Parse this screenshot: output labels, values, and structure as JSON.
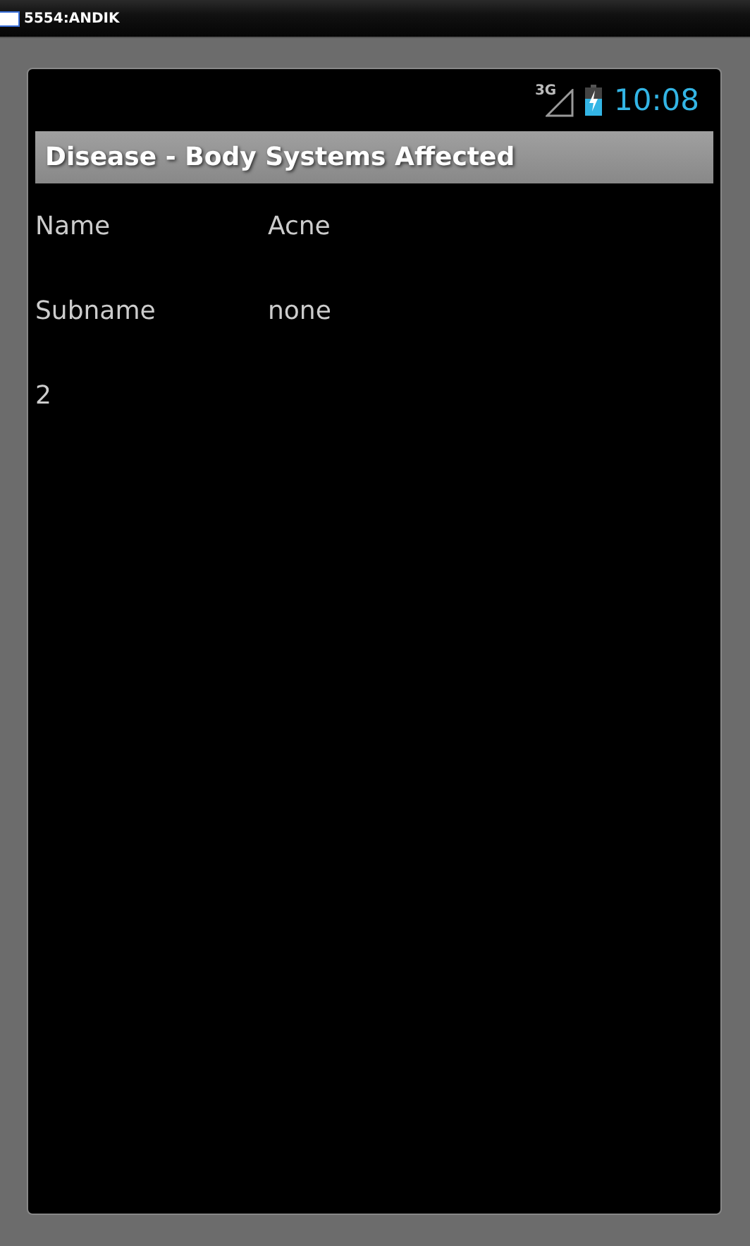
{
  "window": {
    "title": "5554:ANDIK"
  },
  "status_bar": {
    "network": "3G",
    "time": "10:08"
  },
  "action_bar": {
    "title": "Disease - Body Systems Affected"
  },
  "fields": [
    {
      "label": "Name",
      "value": "Acne"
    },
    {
      "label": "Subname",
      "value": "none"
    }
  ],
  "count": "2"
}
